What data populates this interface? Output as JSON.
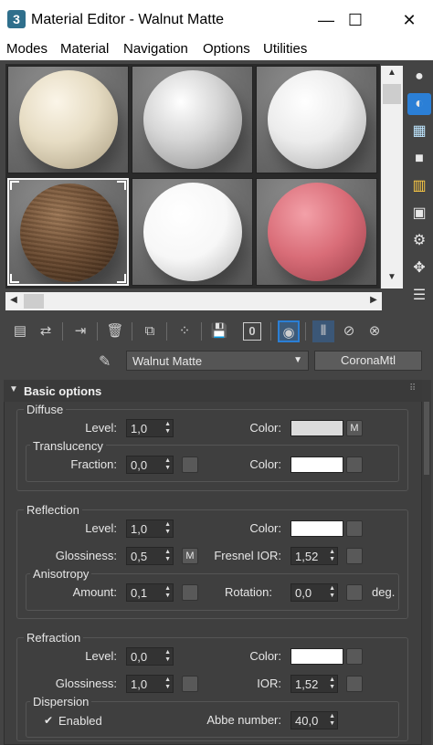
{
  "window": {
    "title": "Material Editor - Walnut Matte",
    "controls": {
      "minimize": "—",
      "maximize": "☐",
      "close": "✕"
    }
  },
  "menu": [
    "Modes",
    "Material",
    "Navigation",
    "Options",
    "Utilities"
  ],
  "slots": [
    {
      "material": "cream",
      "color": "#e6dcc3",
      "selected": false
    },
    {
      "material": "silver",
      "color": "#d6d6d6",
      "selected": false
    },
    {
      "material": "white",
      "color": "#ececec",
      "selected": false
    },
    {
      "material": "walnut",
      "color": "#6a4a30",
      "selected": true
    },
    {
      "material": "white-glossy",
      "color": "#f7f7f7",
      "selected": false
    },
    {
      "material": "pink",
      "color": "#d96d78",
      "selected": false
    }
  ],
  "toolbar": {
    "material_name": "Walnut Matte",
    "material_type": "CoronaMtl",
    "id_channel": "0"
  },
  "rollout": {
    "title": "Basic options",
    "diffuse": {
      "title": "Diffuse",
      "level_label": "Level:",
      "level": "1,0",
      "color_label": "Color:",
      "map_label": "M",
      "translucency_title": "Translucency",
      "fraction_label": "Fraction:",
      "fraction": "0,0",
      "trans_color_label": "Color:"
    },
    "reflection": {
      "title": "Reflection",
      "level_label": "Level:",
      "level": "1,0",
      "color_label": "Color:",
      "glossiness_label": "Glossiness:",
      "glossiness": "0,5",
      "gloss_map_label": "M",
      "fresnel_label": "Fresnel IOR:",
      "fresnel": "1,52",
      "anisotropy_title": "Anisotropy",
      "amount_label": "Amount:",
      "amount": "0,1",
      "rotation_label": "Rotation:",
      "rotation": "0,0",
      "rotation_unit": "deg."
    },
    "refraction": {
      "title": "Refraction",
      "level_label": "Level:",
      "level": "0,0",
      "color_label": "Color:",
      "glossiness_label": "Glossiness:",
      "glossiness": "1,0",
      "ior_label": "IOR:",
      "ior": "1,52",
      "dispersion_title": "Dispersion",
      "enabled_label": "Enabled",
      "enabled": true,
      "abbe_label": "Abbe number:",
      "abbe": "40,0"
    }
  },
  "colors": {
    "diffuse_swatch": "#dcdcdc",
    "white_swatch": "#ffffff",
    "panel_bg": "#444444",
    "active_tool": "#2b7fd6"
  }
}
